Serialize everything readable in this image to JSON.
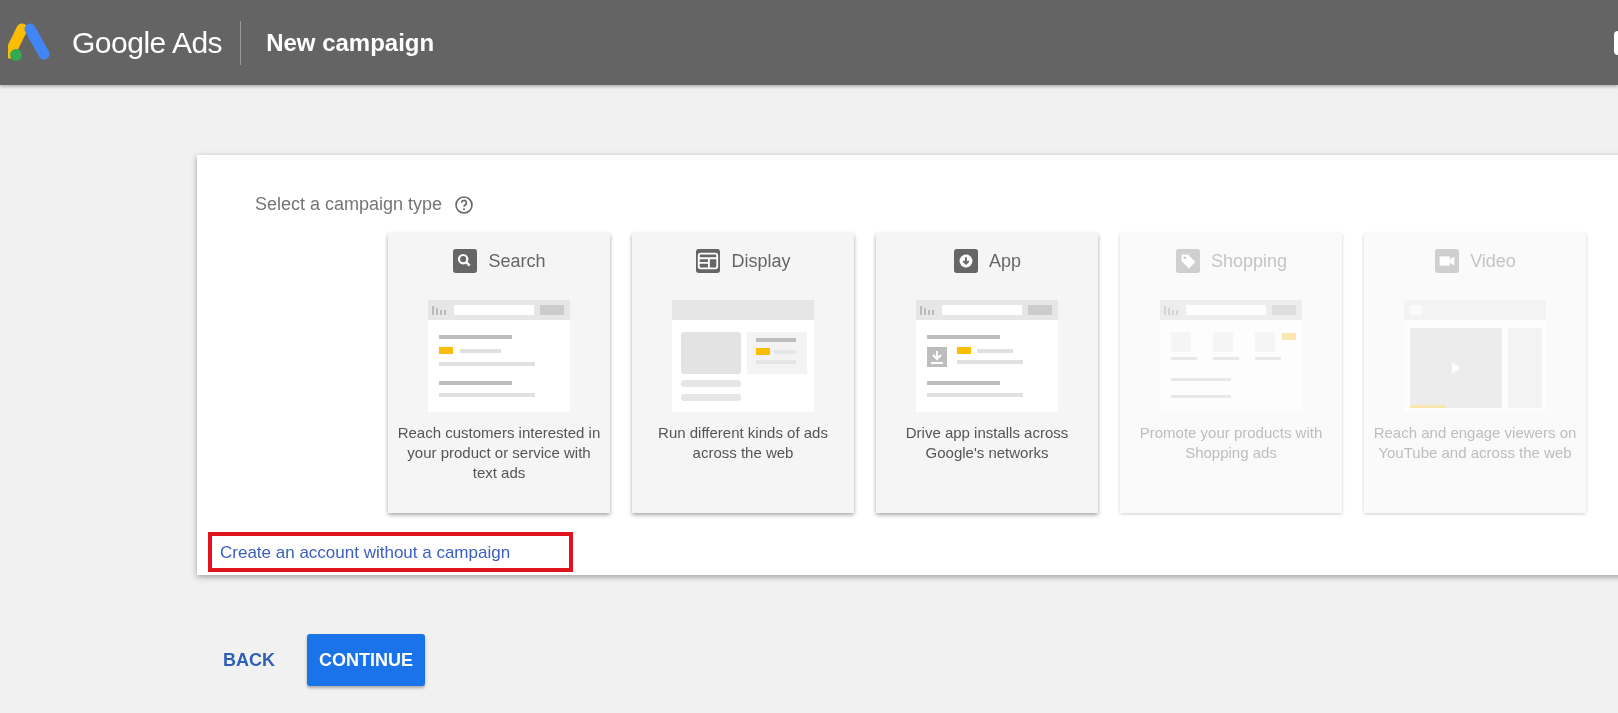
{
  "header": {
    "product": "Google Ads",
    "title": "New campaign"
  },
  "prompt": {
    "label": "Select a campaign type"
  },
  "campaign_types": [
    {
      "kind": "search",
      "label": "Search",
      "description": "Reach customers interested in your product or service with text ads",
      "disabled": false
    },
    {
      "kind": "display",
      "label": "Display",
      "description": "Run different kinds of ads across the web",
      "disabled": false
    },
    {
      "kind": "app",
      "label": "App",
      "description": "Drive app installs across Google's networks",
      "disabled": false
    },
    {
      "kind": "shopping",
      "label": "Shopping",
      "description": "Promote your products with Shopping ads",
      "disabled": true
    },
    {
      "kind": "video",
      "label": "Video",
      "description": "Reach and engage viewers on YouTube and across the web",
      "disabled": true
    }
  ],
  "link": "Create an account without a campaign",
  "buttons": {
    "back": "BACK",
    "continue": "CONTINUE"
  }
}
